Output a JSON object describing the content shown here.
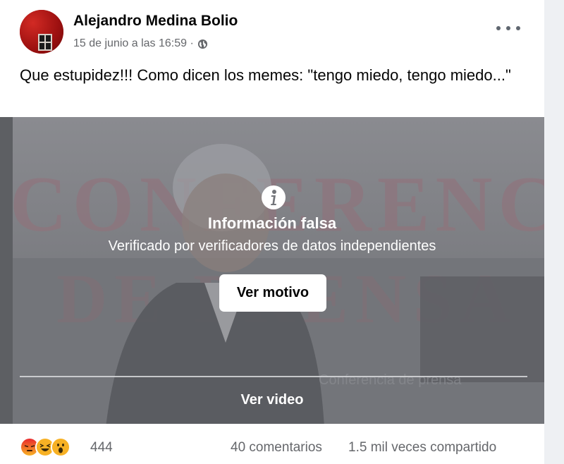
{
  "post": {
    "author": "Alejandro Medina Bolio",
    "timestamp": "15 de junio a las 16:59 ·",
    "privacy_icon": "globe-icon",
    "text": "Que estupidez!!! Como dicen los memes: \"tengo miedo, tengo miedo...\""
  },
  "video": {
    "background_text": "CONFERENCIA",
    "background_text_2": "DE PRENSA",
    "watermark": "Conferencia de prensa",
    "warning_icon": "info-icon",
    "warning_title": "Información falsa",
    "warning_subtitle": "Verificado por verificadores de datos independientes",
    "see_why_label": "Ver motivo",
    "see_video_label": "Ver video"
  },
  "footer": {
    "reactions": [
      "angry-reaction-icon",
      "haha-reaction-icon",
      "wow-reaction-icon"
    ],
    "reaction_count": "444",
    "comments": "40 comentarios",
    "shares": "1.5 mil veces compartido"
  },
  "colors": {
    "secondary_text": "#65676b",
    "overlay": "#73757a",
    "reaction_yellow": "#f7b125",
    "reaction_angry": "#e9710f"
  }
}
